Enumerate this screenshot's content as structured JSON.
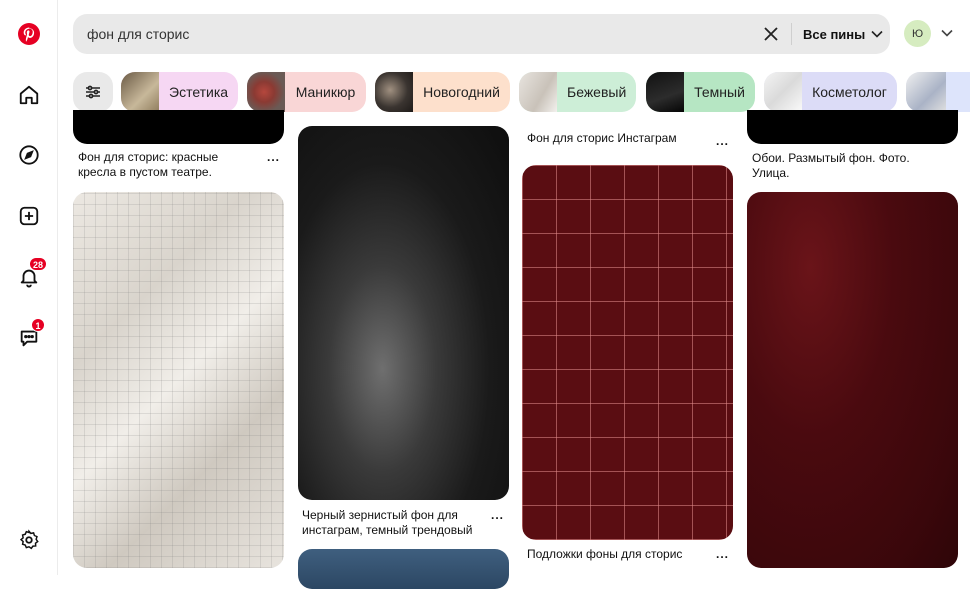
{
  "sidebar": {
    "logo_icon": "pinterest-logo-icon",
    "items": [
      {
        "name": "home-icon"
      },
      {
        "name": "explore-icon"
      },
      {
        "name": "create-icon"
      },
      {
        "name": "notifications-icon",
        "badge": "28"
      },
      {
        "name": "messages-icon",
        "badge": "1"
      }
    ],
    "settings_icon": "gear-icon"
  },
  "search": {
    "value": "фон для сторис",
    "filter_label": "Все пины"
  },
  "account": {
    "initial": "Ю"
  },
  "chips": [
    {
      "label": "Эстетика",
      "color": "#f6d7f3"
    },
    {
      "label": "Маникюр",
      "color": "#f9d6d6"
    },
    {
      "label": "Новогодний",
      "color": "#fde0cc"
    },
    {
      "label": "Бежевый",
      "color": "#cdeed7"
    },
    {
      "label": "Темный",
      "color": "#b6e6c3"
    },
    {
      "label": "Косметолог",
      "color": "#dcdcf7"
    }
  ],
  "pins": {
    "col1_caption": "Фон для сторис: красные кресла в пустом театре. Концептуальн...",
    "col2_caption": "Черный зернистый фон для инстаграм, темный трендовый зе...",
    "col3_top_caption": "Фон для сторис Инстаграм",
    "col3_caption": "Подложки фоны для сторис ри...",
    "col4_caption": "Обои. Размытый фон. Фото. Улица.",
    "more_label": "..."
  },
  "colors": {
    "brand": "#e60023",
    "search_bg": "#e9e9e9"
  }
}
